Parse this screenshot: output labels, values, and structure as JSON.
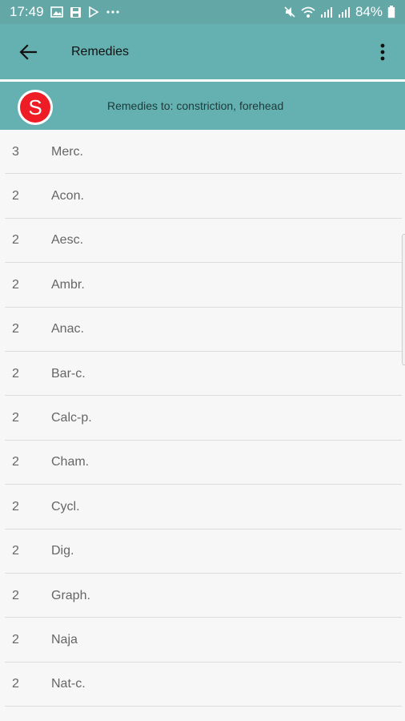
{
  "status_bar": {
    "time": "17:49",
    "battery_percent": "84%",
    "left_icons": [
      "image-icon",
      "save-icon",
      "play-icon",
      "more-dots-icon"
    ],
    "right_icons": [
      "mute-icon",
      "wifi-icon",
      "signal-icon",
      "signal-icon",
      "battery-icon"
    ]
  },
  "app_bar": {
    "title": "Remedies",
    "colors": {
      "bar": "#65b1b1",
      "badge": "#ee1c24"
    }
  },
  "sub_header": {
    "badge_letter": "S",
    "text": "Remedies to: constriction, forehead"
  },
  "remedies": [
    {
      "grade": "3",
      "name": "Merc."
    },
    {
      "grade": "2",
      "name": "Acon."
    },
    {
      "grade": "2",
      "name": "Aesc."
    },
    {
      "grade": "2",
      "name": "Ambr."
    },
    {
      "grade": "2",
      "name": "Anac."
    },
    {
      "grade": "2",
      "name": "Bar-c."
    },
    {
      "grade": "2",
      "name": "Calc-p."
    },
    {
      "grade": "2",
      "name": "Cham."
    },
    {
      "grade": "2",
      "name": "Cycl."
    },
    {
      "grade": "2",
      "name": "Dig."
    },
    {
      "grade": "2",
      "name": "Graph."
    },
    {
      "grade": "2",
      "name": "Naja"
    },
    {
      "grade": "2",
      "name": "Nat-c."
    }
  ]
}
